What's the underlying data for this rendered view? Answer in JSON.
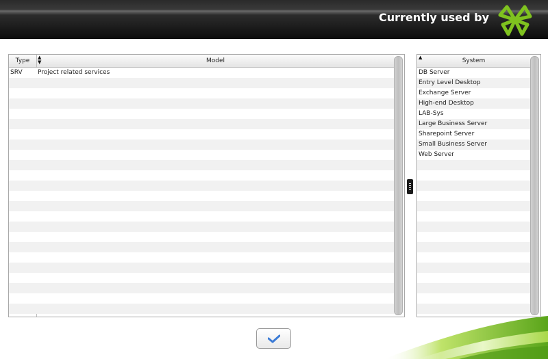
{
  "header": {
    "title": "Currently used by"
  },
  "left_table": {
    "columns": [
      "Type",
      "Model"
    ],
    "rows": [
      {
        "type": "SRV",
        "model": "Project related services"
      }
    ],
    "empty_rows": 23
  },
  "right_table": {
    "columns": [
      "System"
    ],
    "rows": [
      "DB Server",
      "Entry Level Desktop",
      "Exchange Server",
      "High-end Desktop",
      "LAB-Sys",
      "Large Business Server",
      "Sharepoint Server",
      "Small Business Server",
      "Web Server"
    ],
    "empty_rows": 15
  },
  "icons": {
    "logo": "clover-logo-icon",
    "ok": "checkmark-icon",
    "splitter": "grip-icon",
    "sort": "sort-arrow-icon"
  },
  "colors": {
    "accent": "#7fc21f",
    "header": "#1a1a1a",
    "check": "#3b7bd6"
  }
}
